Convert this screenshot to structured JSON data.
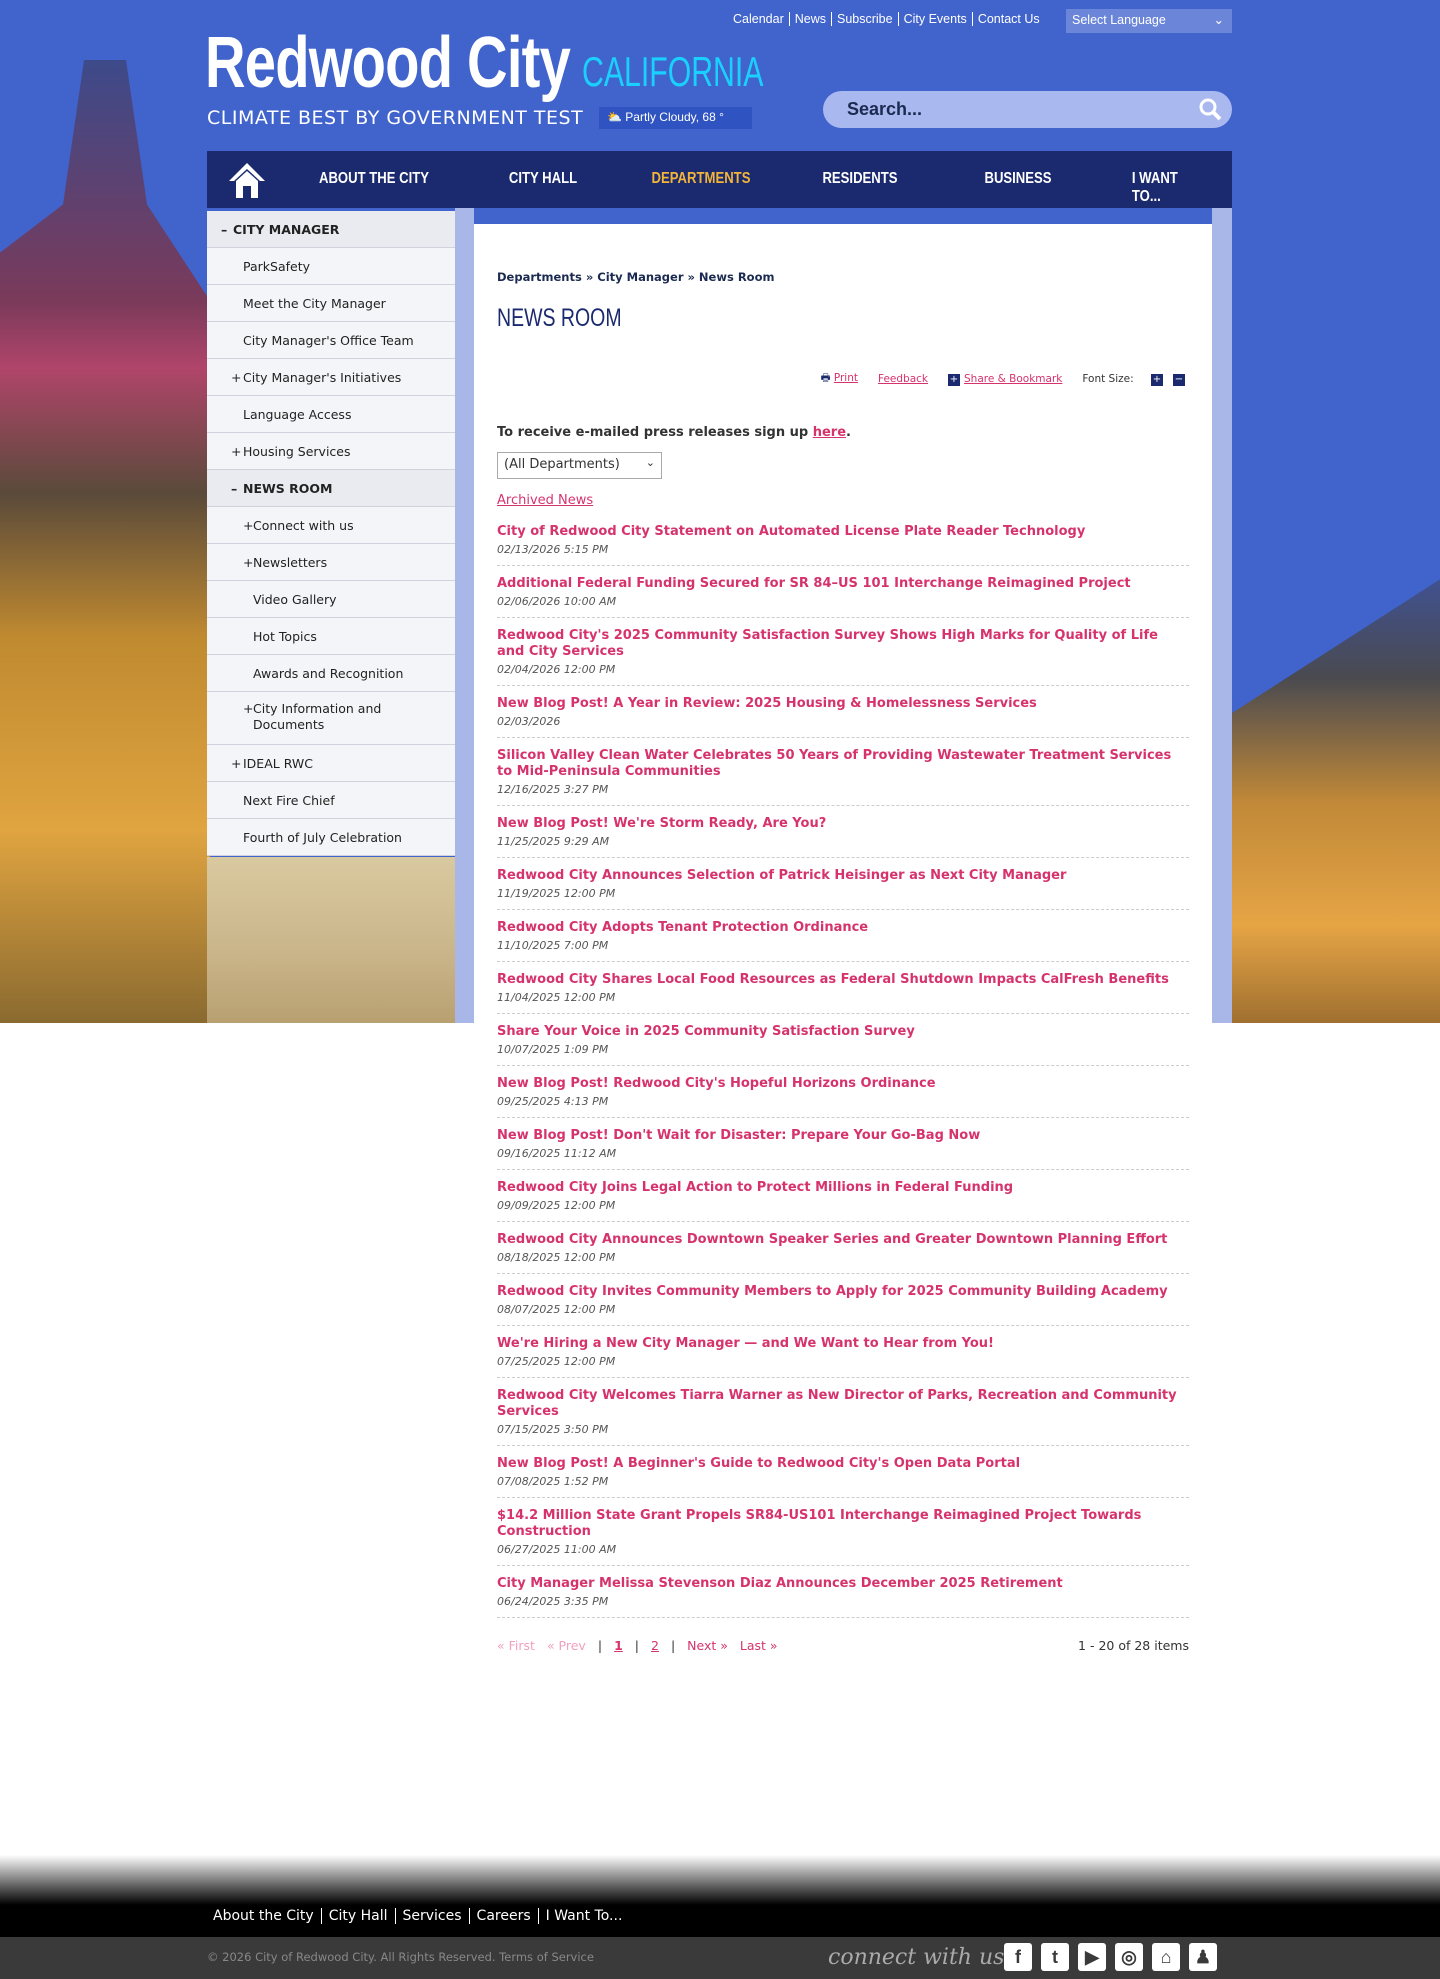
{
  "top_links": [
    "Calendar",
    "News",
    "Subscribe",
    "City Events",
    "Contact Us"
  ],
  "language": "Select Language",
  "logo": {
    "name": "Redwood City",
    "state": "CALIFORNIA",
    "tagline": "CLIMATE BEST BY GOVERNMENT TEST"
  },
  "weather": "Partly Cloudy, 68 °",
  "search": {
    "placeholder": "Search..."
  },
  "nav": [
    "ABOUT THE CITY",
    "CITY HALL",
    "DEPARTMENTS",
    "RESIDENTS",
    "BUSINESS",
    "I WANT TO..."
  ],
  "sidebar": [
    {
      "label": "CITY MANAGER",
      "pm": "–",
      "type": "hd"
    },
    {
      "label": "ParkSafety",
      "pm": "",
      "type": "l1"
    },
    {
      "label": "Meet the City Manager",
      "pm": "",
      "type": "l1"
    },
    {
      "label": "City Manager's Office Team",
      "pm": "",
      "type": "l1"
    },
    {
      "label": "City Manager's Initiatives",
      "pm": "+",
      "type": "l1"
    },
    {
      "label": "Language Access",
      "pm": "",
      "type": "l1"
    },
    {
      "label": "Housing Services",
      "pm": "+",
      "type": "l1"
    },
    {
      "label": "NEWS ROOM",
      "pm": "–",
      "type": "hd2"
    },
    {
      "label": "Connect with us",
      "pm": "+",
      "type": "l2"
    },
    {
      "label": "Newsletters",
      "pm": "+",
      "type": "l2"
    },
    {
      "label": "Video Gallery",
      "pm": "",
      "type": "l2"
    },
    {
      "label": "Hot Topics",
      "pm": "",
      "type": "l2"
    },
    {
      "label": "Awards and Recognition",
      "pm": "",
      "type": "l2"
    },
    {
      "label": "City Information and Documents",
      "pm": "+",
      "type": "l2"
    },
    {
      "label": "IDEAL RWC",
      "pm": "+",
      "type": "l1"
    },
    {
      "label": "Next Fire Chief",
      "pm": "",
      "type": "l1"
    },
    {
      "label": "Fourth of July Celebration",
      "pm": "",
      "type": "l1"
    }
  ],
  "breadcrumb": "Departments » City Manager » News Room",
  "title": "NEWS ROOM",
  "tools": {
    "print": "Print",
    "feedback": "Feedback",
    "share": "Share & Bookmark",
    "font_size": "Font Size:"
  },
  "signup": {
    "text": "To receive e-mailed press releases sign up ",
    "link": "here",
    "end": "."
  },
  "department_filter": "(All Departments)",
  "archived": "Archived News",
  "news": [
    {
      "t": "City of Redwood City Statement on Automated License Plate Reader Technology",
      "d": "02/13/2026 5:15 PM"
    },
    {
      "t": "Additional Federal Funding Secured for SR 84–US 101 Interchange Reimagined Project",
      "d": "02/06/2026 10:00 AM"
    },
    {
      "t": "Redwood City's 2025 Community Satisfaction Survey Shows High Marks for Quality of Life and City Services",
      "d": "02/04/2026 12:00 PM"
    },
    {
      "t": "New Blog Post! A Year in Review: 2025 Housing & Homelessness Services",
      "d": "02/03/2026"
    },
    {
      "t": "Silicon Valley Clean Water Celebrates 50 Years of Providing Wastewater Treatment Services to Mid-Peninsula Communities",
      "d": "12/16/2025 3:27 PM"
    },
    {
      "t": "New Blog Post! We're Storm Ready, Are You?",
      "d": "11/25/2025 9:29 AM"
    },
    {
      "t": "Redwood City Announces Selection of Patrick Heisinger as Next City Manager",
      "d": "11/19/2025 12:00 PM"
    },
    {
      "t": "Redwood City Adopts Tenant Protection Ordinance",
      "d": "11/10/2025 7:00 PM"
    },
    {
      "t": "Redwood City Shares Local Food Resources as Federal Shutdown Impacts CalFresh Benefits",
      "d": "11/04/2025 12:00 PM"
    },
    {
      "t": "Share Your Voice in 2025 Community Satisfaction Survey",
      "d": "10/07/2025 1:09 PM"
    },
    {
      "t": "New Blog Post! Redwood City's Hopeful Horizons Ordinance",
      "d": "09/25/2025 4:13 PM"
    },
    {
      "t": "New Blog Post! Don't Wait for Disaster: Prepare Your Go-Bag Now",
      "d": "09/16/2025 11:12 AM"
    },
    {
      "t": "Redwood City Joins Legal Action to Protect Millions in Federal Funding",
      "d": "09/09/2025 12:00 PM"
    },
    {
      "t": "Redwood City Announces Downtown Speaker Series and Greater Downtown Planning Effort",
      "d": "08/18/2025 12:00 PM"
    },
    {
      "t": "Redwood City Invites Community Members to Apply for 2025 Community Building Academy",
      "d": "08/07/2025 12:00 PM"
    },
    {
      "t": "We're Hiring a New City Manager — and We Want to Hear from You!",
      "d": "07/25/2025 12:00 PM"
    },
    {
      "t": "Redwood City Welcomes Tiarra Warner as New Director of Parks, Recreation and Community Services",
      "d": "07/15/2025 3:50 PM"
    },
    {
      "t": "New Blog Post! A Beginner's Guide to Redwood City's Open Data Portal",
      "d": "07/08/2025 1:52 PM"
    },
    {
      "t": "$14.2 Million State Grant Propels SR84-US101 Interchange Reimagined Project Towards Construction",
      "d": "06/27/2025 11:00 AM"
    },
    {
      "t": "City Manager Melissa Stevenson Diaz Announces December 2025 Retirement",
      "d": "06/24/2025 3:35 PM"
    }
  ],
  "pager": {
    "first": "« First",
    "prev": "« Prev",
    "p1": "1",
    "p2": "2",
    "next": "Next »",
    "last": "Last »",
    "sep": "|",
    "count": "1 - 20 of 28 items"
  },
  "footer": {
    "links": [
      "About the City",
      "City Hall",
      "Services",
      "Careers",
      "I Want To..."
    ],
    "copyright": "© 2026 City of Redwood City. All Rights Reserved. Terms of Service",
    "connect": "connect with us"
  }
}
